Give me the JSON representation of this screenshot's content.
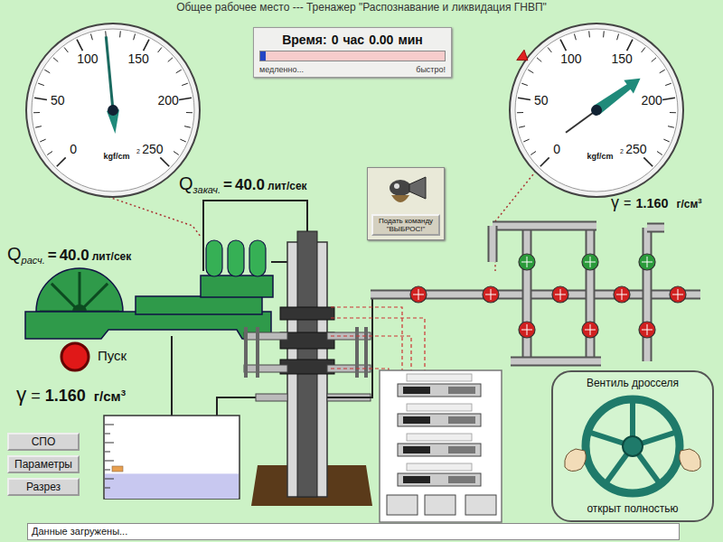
{
  "window": {
    "title": "Общее рабочее место --- Тренажер \"Распознавание и ликвидация ГНВП\""
  },
  "timer": {
    "label": "Время:",
    "hours": "0",
    "hours_unit": "час",
    "minutes": "0.00",
    "minutes_unit": "мин",
    "speed": {
      "level": 0.03,
      "slow": "медленно...",
      "fast": "быстро!"
    }
  },
  "gauges": [
    {
      "ticks": [
        "0",
        "50",
        "100",
        "150",
        "200",
        "250"
      ],
      "unit": "kgf/cm",
      "unit_exp": "2",
      "level": 0.48
    },
    {
      "ticks": [
        "0",
        "50",
        "100",
        "150",
        "200",
        "250"
      ],
      "unit": "kgf/cm",
      "unit_exp": "2",
      "level": 0.7,
      "limit_level": 0.3
    }
  ],
  "flows": [
    {
      "symbol": "Q",
      "subscript": "закач.",
      "equals": "=",
      "value": "40.0",
      "unit": "лит/сек"
    },
    {
      "symbol": "Q",
      "subscript": "расч.",
      "equals": "=",
      "value": "40.0",
      "unit": "лит/сек"
    }
  ],
  "densities": [
    {
      "symbol": "γ",
      "equals": "=",
      "value": "1.160",
      "unit": "г/см",
      "exp": "3"
    },
    {
      "symbol": "γ",
      "equals": "=",
      "value": "1.160",
      "unit": "г/см",
      "exp": "3"
    }
  ],
  "command_button": {
    "lines": [
      "Подать команду",
      "\"ВЫБРОС!\""
    ]
  },
  "pump": {
    "start_label": "Пуск"
  },
  "side_buttons": [
    "СПО",
    "Параметры",
    "Разрез"
  ],
  "tank": {
    "level": 0.3
  },
  "manifold": {
    "valves": [
      {
        "color": "#d02020"
      },
      {
        "color": "#d02020"
      },
      {
        "color": "#2a9a3a"
      },
      {
        "color": "#d02020"
      },
      {
        "color": "#d02020"
      },
      {
        "color": "#2a9a3a"
      },
      {
        "color": "#d02020"
      },
      {
        "color": "#d02020"
      },
      {
        "color": "#2a9a3a"
      },
      {
        "color": "#d02020"
      },
      {
        "color": "#d02020"
      }
    ]
  },
  "choke": {
    "title": "Вентиль дросселя",
    "status": "открыт полностью"
  },
  "status_bar": "Данные загружены..."
}
